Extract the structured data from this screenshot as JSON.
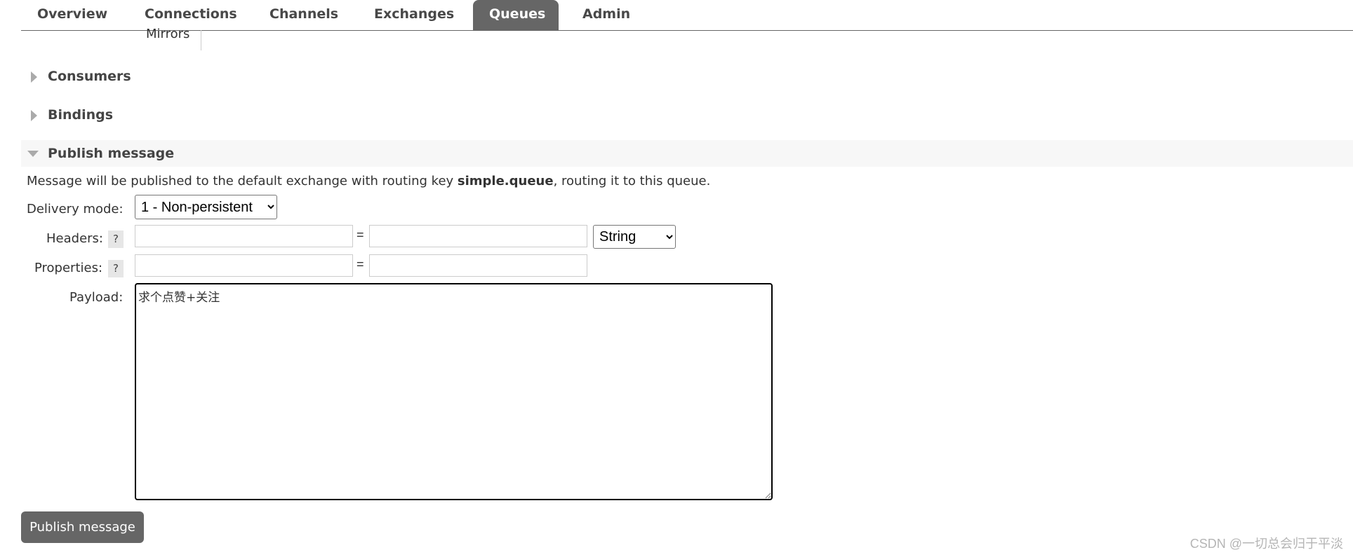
{
  "nav": {
    "tabs": [
      {
        "label": "Overview"
      },
      {
        "label": "Connections"
      },
      {
        "label": "Channels"
      },
      {
        "label": "Exchanges"
      },
      {
        "label": "Queues",
        "active": true
      },
      {
        "label": "Admin"
      }
    ]
  },
  "subnav": {
    "mirrors_label": "Mirrors"
  },
  "sections": {
    "consumers": {
      "title": "Consumers",
      "expanded": false
    },
    "bindings": {
      "title": "Bindings",
      "expanded": false
    },
    "publish": {
      "title": "Publish message",
      "expanded": true
    }
  },
  "publish_form": {
    "info_prefix": "Message will be published to the default exchange with routing key ",
    "routing_key": "simple.queue",
    "info_suffix": ", routing it to this queue.",
    "delivery_mode_label": "Delivery mode:",
    "delivery_mode_value": "1 - Non-persistent",
    "headers_label": "Headers:",
    "headers_help": "?",
    "headers_type_value": "String",
    "properties_label": "Properties:",
    "properties_help": "?",
    "equals": "=",
    "payload_label": "Payload:",
    "payload_value": "求个点赞+关注",
    "submit_label": "Publish message"
  },
  "watermark": "CSDN @一切总会归于平淡",
  "colors": {
    "active_tab_bg": "#666666",
    "button_bg": "#666666",
    "section_bg": "#f7f7f7",
    "triangle": "#aaaaaa"
  }
}
